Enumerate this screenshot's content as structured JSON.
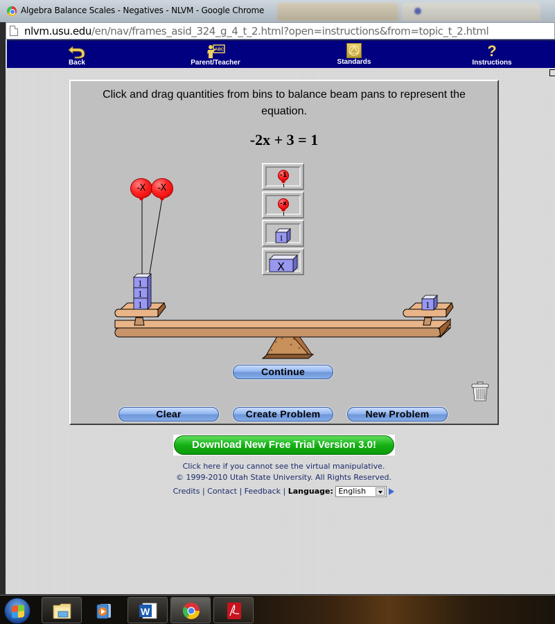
{
  "window": {
    "title": "Algebra Balance Scales - Negatives - NLVM - Google Chrome",
    "url_host": "nlvm.usu.edu",
    "url_path": "/en/nav/frames_asid_324_g_4_t_2.html?open=instructions&from=topic_t_2.html"
  },
  "navbar": {
    "items": [
      {
        "label": "Back",
        "icon": "back-arrow-icon"
      },
      {
        "label": "Parent/Teacher",
        "icon": "teacher-icon"
      },
      {
        "label": "Standards",
        "icon": "standards-icon"
      },
      {
        "label": "Instructions",
        "icon": "question-mark-icon"
      }
    ]
  },
  "applet": {
    "instructions": "Click and drag quantities from bins to balance beam pans to represent the equation.",
    "equation": "-2x + 3 = 1",
    "bins": [
      {
        "label": "-1",
        "kind": "negative-unit-balloon"
      },
      {
        "label": "-x",
        "kind": "negative-x-balloon"
      },
      {
        "label": "1",
        "kind": "unit-block"
      },
      {
        "label": "X",
        "kind": "x-block"
      }
    ],
    "left_pan": {
      "balloons": [
        "-X",
        "-X"
      ],
      "blocks": [
        "1",
        "1",
        "1"
      ]
    },
    "right_pan": {
      "blocks": [
        "1"
      ]
    },
    "buttons": {
      "continue": "Continue",
      "clear": "Clear",
      "create_problem": "Create Problem",
      "new_problem": "New Problem"
    }
  },
  "footer": {
    "download": "Download New Free Trial Version 3.0!",
    "cannot_see": "Click here if you cannot see the virtual manipulative.",
    "copyright": "© 1999-2010 Utah State University. All Rights Reserved.",
    "links": [
      "Credits",
      "Contact",
      "Feedback"
    ],
    "language_label": "Language:",
    "language_value": "English"
  },
  "taskbar": {
    "items": [
      "start",
      "windows-explorer",
      "windows-media-player",
      "microsoft-word",
      "google-chrome",
      "adobe-acrobat"
    ]
  }
}
